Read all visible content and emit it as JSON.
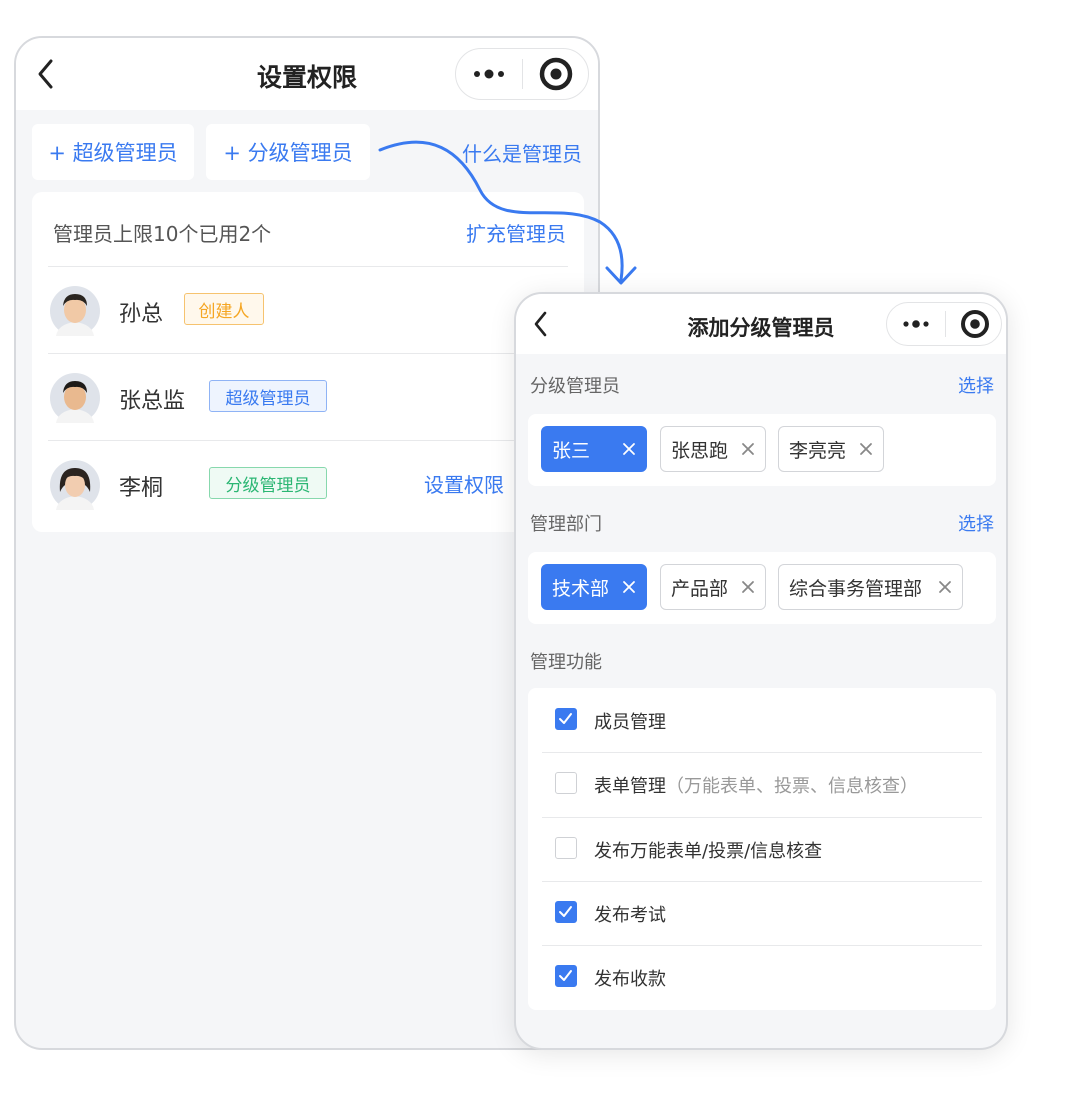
{
  "left_screen": {
    "title": "设置权限",
    "add_super_admin": "+ 超级管理员",
    "add_sub_admin": "+ 分级管理员",
    "what_is_admin": "什么是管理员",
    "quota_text": "管理员上限10个已用2个",
    "expand_link": "扩充管理员",
    "admins": [
      {
        "name": "孙总",
        "role": "创建人",
        "role_color": "#f5a623"
      },
      {
        "name": "张总监",
        "role": "超级管理员",
        "role_color": "#3a7af0"
      },
      {
        "name": "李桐",
        "role": "分级管理员",
        "role_color": "#2bb673",
        "action": "设置权限"
      }
    ]
  },
  "right_screen": {
    "title": "添加分级管理员",
    "sub_admin_section": "分级管理员",
    "select_label": "选择",
    "sub_admins": [
      {
        "label": "张三",
        "selected": true
      },
      {
        "label": "张思跑",
        "selected": false
      },
      {
        "label": "李亮亮",
        "selected": false
      }
    ],
    "dept_section": "管理部门",
    "select_label_2": "选择",
    "departments": [
      {
        "label": "技术部",
        "selected": true
      },
      {
        "label": "产品部",
        "selected": false
      },
      {
        "label": "综合事务管理部",
        "selected": false
      }
    ],
    "func_section": "管理功能",
    "functions": [
      {
        "label": "成员管理",
        "checked": true
      },
      {
        "label": "表单管理",
        "note": "（万能表单、投票、信息核查）",
        "checked": false
      },
      {
        "label": "发布万能表单/投票/信息核查",
        "checked": false
      },
      {
        "label": "发布考试",
        "checked": true
      },
      {
        "label": "发布收款",
        "checked": true
      }
    ]
  },
  "colors": {
    "accent": "#3a7af0",
    "creator_badge": "#f5a623",
    "super_badge": "#3a7af0",
    "sub_badge": "#2bb673",
    "background": "#f5f6f8"
  },
  "icons": [
    "back-icon",
    "more-icon",
    "record-icon",
    "close-icon",
    "check-icon",
    "avatar"
  ]
}
